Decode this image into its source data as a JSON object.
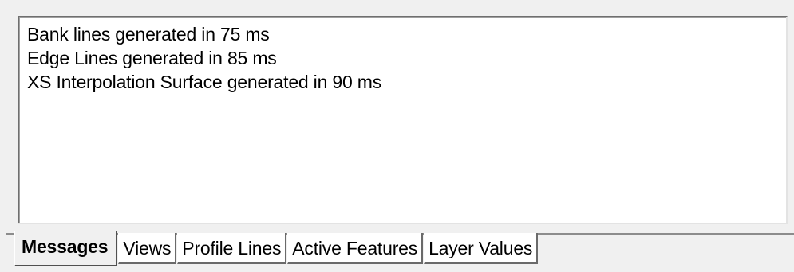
{
  "messages": [
    "Bank lines generated in 75 ms",
    "Edge Lines generated in 85 ms",
    "XS Interpolation Surface generated in 90 ms"
  ],
  "tabs": [
    {
      "label": "Messages",
      "active": true
    },
    {
      "label": "Views",
      "active": false
    },
    {
      "label": "Profile Lines",
      "active": false
    },
    {
      "label": "Active Features",
      "active": false
    },
    {
      "label": "Layer Values",
      "active": false
    }
  ]
}
